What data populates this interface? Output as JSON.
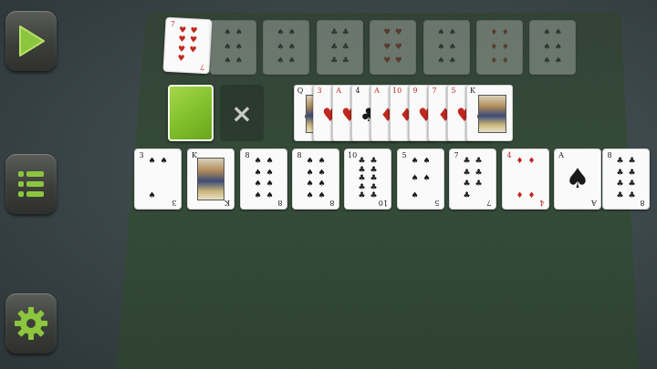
{
  "sidebar": {
    "play_icon": "play-icon",
    "menu_icon": "menu-list-icon",
    "settings_icon": "gear-icon"
  },
  "colors": {
    "felt": "#2c4330",
    "accent_green": "#8cc63f",
    "background": "#3a4548"
  },
  "foundation_row": [
    {
      "rank": "7",
      "suit": "♥",
      "color": "red",
      "ghost": false
    },
    {
      "rank": "",
      "suit": "♠",
      "color": "black",
      "ghost": true
    },
    {
      "rank": "",
      "suit": "♠",
      "color": "black",
      "ghost": true
    },
    {
      "rank": "",
      "suit": "♣",
      "color": "black",
      "ghost": true
    },
    {
      "rank": "",
      "suit": "♥",
      "color": "red",
      "ghost": true
    },
    {
      "rank": "",
      "suit": "♠",
      "color": "black",
      "ghost": true
    },
    {
      "rank": "",
      "suit": "♦",
      "color": "red",
      "ghost": true
    },
    {
      "rank": "",
      "suit": "♠",
      "color": "black",
      "ghost": true
    }
  ],
  "stock": {
    "label": ""
  },
  "discard_slot": {
    "icon": "×"
  },
  "waste_fan": [
    {
      "rank": "Q",
      "suit": "♣",
      "color": "black"
    },
    {
      "rank": "3",
      "suit": "♥",
      "color": "red"
    },
    {
      "rank": "A",
      "suit": "♥",
      "color": "red"
    },
    {
      "rank": "4",
      "suit": "♣",
      "color": "black"
    },
    {
      "rank": "A",
      "suit": "♦",
      "color": "red"
    },
    {
      "rank": "10",
      "suit": "♦",
      "color": "red"
    },
    {
      "rank": "9",
      "suit": "♥",
      "color": "red"
    },
    {
      "rank": "7",
      "suit": "♦",
      "color": "red"
    },
    {
      "rank": "5",
      "suit": "♥",
      "color": "red"
    },
    {
      "rank": "K",
      "suit": "♣",
      "color": "black"
    }
  ],
  "tableau_row": [
    {
      "rank": "3",
      "suit": "♠",
      "color": "black"
    },
    {
      "rank": "K",
      "suit": "♣",
      "color": "black"
    },
    {
      "rank": "8",
      "suit": "♠",
      "color": "black"
    },
    {
      "rank": "8",
      "suit": "♠",
      "color": "black"
    },
    {
      "rank": "10",
      "suit": "♣",
      "color": "black"
    },
    {
      "rank": "5",
      "suit": "♠",
      "color": "black"
    },
    {
      "rank": "7",
      "suit": "♣",
      "color": "black"
    },
    {
      "rank": "4",
      "suit": "♦",
      "color": "red"
    },
    {
      "rank": "A",
      "suit": "♠",
      "color": "black"
    },
    {
      "rank": "8",
      "suit": "♣",
      "color": "black"
    }
  ]
}
